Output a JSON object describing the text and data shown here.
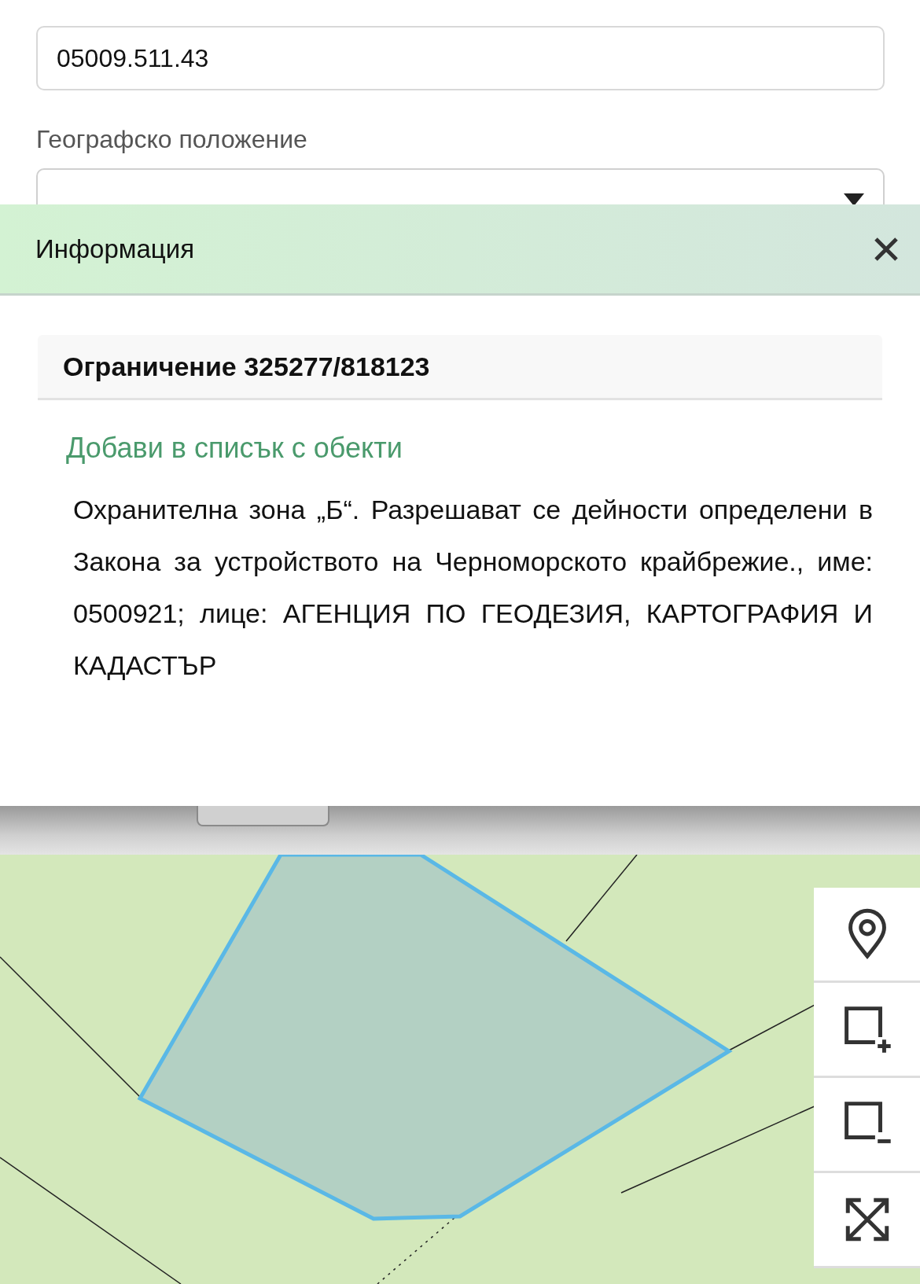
{
  "form": {
    "parcel_id": "05009.511.43",
    "location_label": "Географско положение"
  },
  "info_dialog": {
    "title": "Информация",
    "section_title": "Ограничение 325277/818123",
    "add_link": "Добави в списък с обекти",
    "description": "Охранителна зона „Б“. Разрешават се дейности определени в Закона за устройството на Черноморското крайбрежие., име: 0500921; лице: АГЕНЦИЯ ПО ГЕОДЕЗИЯ, КАРТОГРАФИЯ И КАДАСТЪР"
  },
  "map": {
    "controls": [
      {
        "kind": "pin"
      },
      {
        "kind": "add-area"
      },
      {
        "kind": "remove-area"
      },
      {
        "kind": "fullscreen"
      }
    ]
  }
}
